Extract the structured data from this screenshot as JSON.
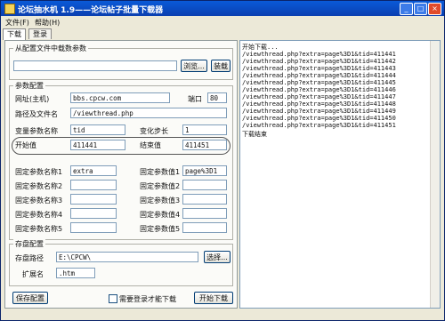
{
  "window": {
    "title": "论坛抽水机 1.9——论坛帖子批量下载器",
    "controls": {
      "minimize": "_",
      "maximize": "□",
      "close": "×"
    }
  },
  "menu": {
    "file": "文件(F)",
    "help": "帮助(H)"
  },
  "tabs": [
    "下载",
    "登录"
  ],
  "load_group": {
    "label": "从配置文件中载数参数",
    "file_value": "",
    "browse": "浏览...",
    "load": "装载"
  },
  "params": {
    "label": "参数配置",
    "site_label": "网址(主机)",
    "site_value": "bbs.cpcw.com",
    "port_label": "端口",
    "port_value": "80",
    "path_label": "路径及文件名",
    "path_value": "/viewthread.php",
    "var_name_label": "变量参数名称",
    "var_name_value": "tid",
    "step_label": "变化步长",
    "step_value": "1",
    "start_label": "开始值",
    "start_value": "411441",
    "end_label": "结束值",
    "end_value": "411451",
    "fixed_names": [
      {
        "label": "固定参数名称1",
        "value": "extra"
      },
      {
        "label": "固定参数名称2",
        "value": ""
      },
      {
        "label": "固定参数名称3",
        "value": ""
      },
      {
        "label": "固定参数名称4",
        "value": ""
      },
      {
        "label": "固定参数名称5",
        "value": ""
      }
    ],
    "fixed_values": [
      {
        "label": "固定参数值1",
        "value": "page%3D1"
      },
      {
        "label": "固定参数值2",
        "value": ""
      },
      {
        "label": "固定参数值3",
        "value": ""
      },
      {
        "label": "固定参数值4",
        "value": ""
      },
      {
        "label": "固定参数值5",
        "value": ""
      }
    ]
  },
  "storage": {
    "label": "存盘配置",
    "path_label": "存盘路径",
    "path_value": "E:\\CPCW\\",
    "choose": "选择...",
    "ext_label": "扩展名",
    "ext_value": ".htm"
  },
  "bottom": {
    "save": "保存配置",
    "login_check": "需要登录才能下载",
    "start": "开始下载"
  },
  "log": [
    "开始下载...",
    "/viewthread.php?extra=page%3D1&tid=411441",
    "/viewthread.php?extra=page%3D1&tid=411442",
    "/viewthread.php?extra=page%3D1&tid=411443",
    "/viewthread.php?extra=page%3D1&tid=411444",
    "/viewthread.php?extra=page%3D1&tid=411445",
    "/viewthread.php?extra=page%3D1&tid=411446",
    "/viewthread.php?extra=page%3D1&tid=411447",
    "/viewthread.php?extra=page%3D1&tid=411448",
    "/viewthread.php?extra=page%3D1&tid=411449",
    "/viewthread.php?extra=page%3D1&tid=411450",
    "/viewthread.php?extra=page%3D1&tid=411451",
    "下载结束"
  ]
}
